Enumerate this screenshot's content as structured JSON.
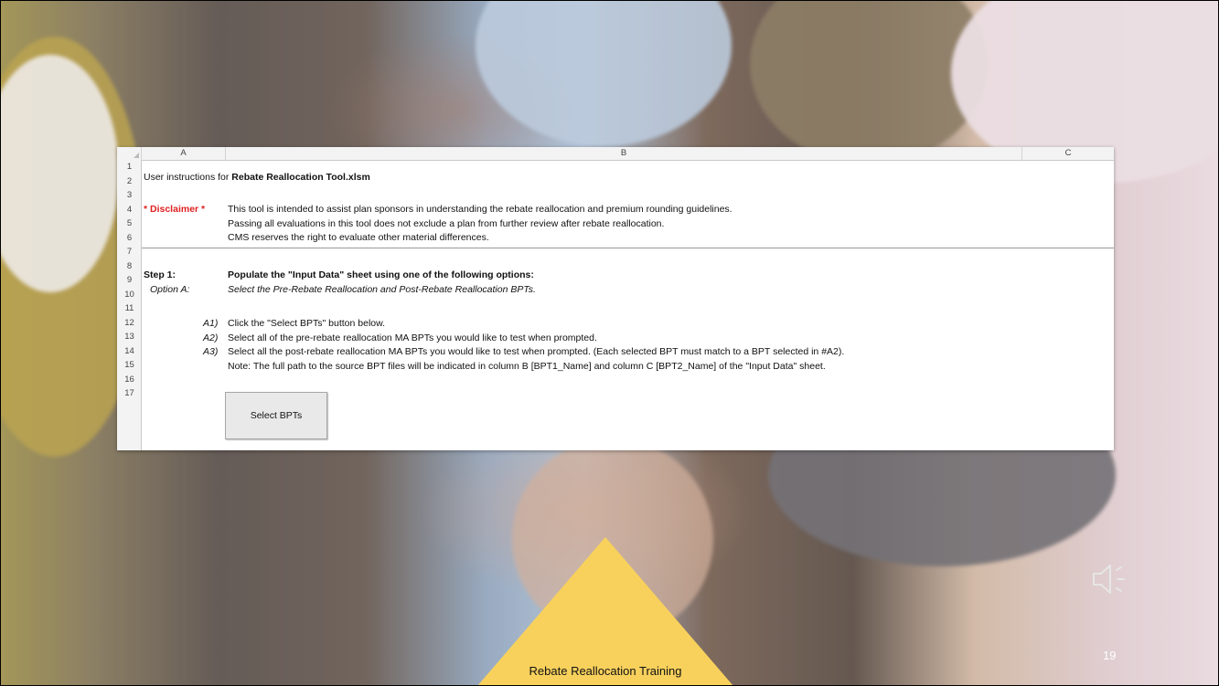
{
  "slide": {
    "page_number": "19",
    "footer": "Rebate Reallocation Training",
    "audio_icon": "speaker-icon"
  },
  "sheet": {
    "columns": [
      "A",
      "B",
      "C"
    ],
    "rows": [
      "1",
      "2",
      "3",
      "4",
      "5",
      "6",
      "7",
      "8",
      "9",
      "10",
      "11",
      "12",
      "13",
      "14",
      "15",
      "16",
      "17"
    ],
    "title_prefix": "User instructions for ",
    "title_file": "Rebate Reallocation Tool.xlsm",
    "disclaimer_label": "* Disclaimer *",
    "disclaimer_lines": [
      "This tool is intended to assist plan sponsors in understanding the rebate reallocation and premium rounding guidelines.",
      "Passing all evaluations in this tool does not exclude a plan from further review after rebate reallocation.",
      "CMS reserves the right to evaluate other material differences."
    ],
    "step1_label": "Step 1:",
    "step1_text": "Populate the \"Input Data\" sheet using one of the following options:",
    "optionA_label": "Option A:",
    "optionA_text": "Select the Pre-Rebate Reallocation and Post-Rebate Reallocation BPTs.",
    "a1_label": "A1)",
    "a1_text": "Click the \"Select BPTs\" button below.",
    "a2_label": "A2)",
    "a2_text": "Select all of the pre-rebate reallocation MA BPTs you would like to test when prompted.",
    "a3_label": "A3)",
    "a3_text": "Select all the post-rebate reallocation MA BPTs you would like to test when prompted. (Each selected BPT must match to a BPT selected in #A2).",
    "note_text": "Note: The full path to the source BPT files will be indicated in column B [BPT1_Name] and column C [BPT2_Name] of the \"Input Data\" sheet.",
    "button_label": "Select BPTs"
  },
  "colors": {
    "triangle": "#f8d15c",
    "disclaimer": "#e02020"
  }
}
